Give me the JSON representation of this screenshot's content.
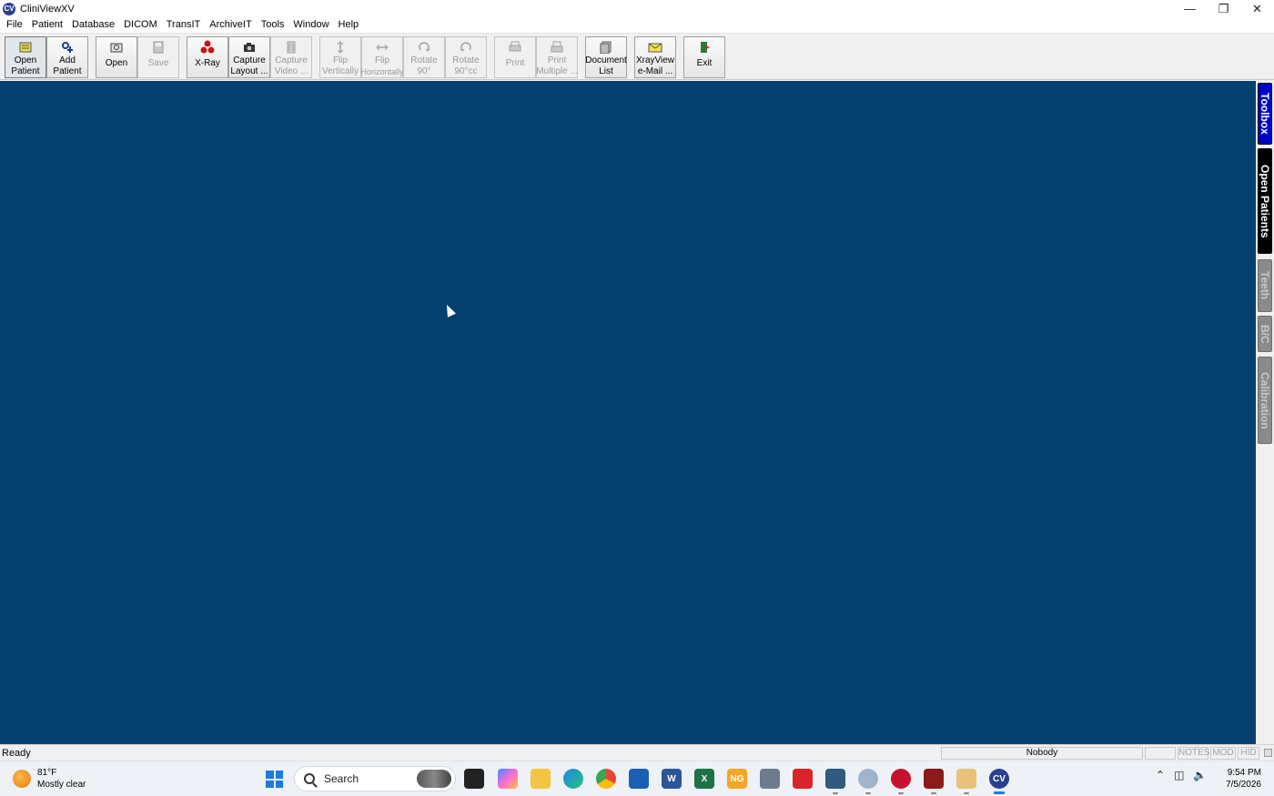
{
  "window": {
    "title": "CliniViewXV",
    "logo_text": "CV"
  },
  "menu": [
    "File",
    "Patient",
    "Database",
    "DICOM",
    "TransIT",
    "ArchiveIT",
    "Tools",
    "Window",
    "Help"
  ],
  "toolbar": {
    "open_patient": {
      "line1": "Open",
      "line2": "Patient"
    },
    "add_patient": {
      "line1": "Add",
      "line2": "Patient"
    },
    "open": {
      "line1": "Open",
      "line2": ""
    },
    "save": {
      "line1": "Save",
      "line2": ""
    },
    "xray": {
      "line1": "X-Ray",
      "line2": ""
    },
    "capture_layout": {
      "line1": "Capture",
      "line2": "Layout ..."
    },
    "capture_video": {
      "line1": "Capture",
      "line2": "Video ..."
    },
    "flip_vertically": {
      "line1": "Flip",
      "line2": "Vertically"
    },
    "flip_horizontally": {
      "line1": "Flip",
      "line2": "Horizontally"
    },
    "rotate_90": {
      "line1": "Rotate",
      "line2": "90°"
    },
    "rotate_90cc": {
      "line1": "Rotate",
      "line2": "90°cc"
    },
    "print": {
      "line1": "Print",
      "line2": ""
    },
    "print_multiple": {
      "line1": "Print",
      "line2": "Multiple ..."
    },
    "document_list": {
      "line1": "Document",
      "line2": "List"
    },
    "xrayview_email": {
      "line1": "XrayView",
      "line2": "e-Mail ..."
    },
    "exit": {
      "line1": "Exit",
      "line2": ""
    }
  },
  "side_tabs": {
    "toolbox": "Toolbox",
    "open_patients": "Open Patients",
    "teeth": "Teeth",
    "bc": "B/C",
    "calibration": "Calibration"
  },
  "status": {
    "ready": "Ready",
    "user": "Nobody",
    "notes": "NOTES",
    "mod": "MOD",
    "hid": "HID"
  },
  "taskbar": {
    "temperature": "81°F",
    "condition": "Mostly clear",
    "search_label": "Search",
    "time": "9:54 PM",
    "date": "7/5/2026"
  },
  "colors": {
    "workspace": "#034070",
    "active_tab": "#0000cc"
  }
}
